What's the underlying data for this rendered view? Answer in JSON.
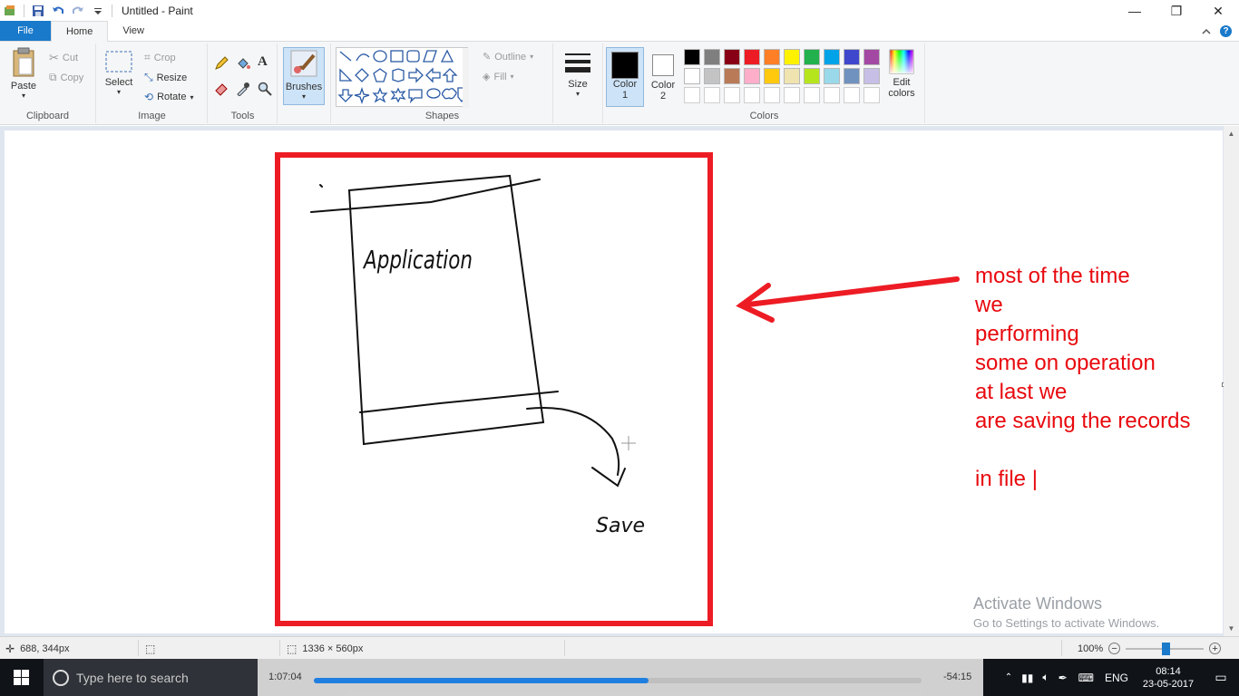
{
  "window": {
    "title": "Untitled - Paint",
    "minimize": "—",
    "maximize": "❐",
    "close": "✕"
  },
  "tabs": [
    "File",
    "Home",
    "View"
  ],
  "ribbon": {
    "clipboard": {
      "label": "Clipboard",
      "paste": "Paste",
      "cut": "Cut",
      "copy": "Copy"
    },
    "image": {
      "label": "Image",
      "select": "Select",
      "crop": "Crop",
      "resize": "Resize",
      "rotate": "Rotate"
    },
    "tools": {
      "label": "Tools"
    },
    "brushes": {
      "label": "Brushes"
    },
    "shapes": {
      "label": "Shapes",
      "outline": "Outline",
      "fill": "Fill"
    },
    "size": {
      "label": "Size"
    },
    "colors": {
      "label": "Colors",
      "color1": "Color",
      "color1_num": "1",
      "color2": "Color",
      "color2_num": "2",
      "edit": "Edit",
      "edit2": "colors",
      "color1_value": "#000000",
      "color2_value": "#ffffff",
      "row1": [
        "#000000",
        "#7f7f7f",
        "#880015",
        "#ed1c24",
        "#ff7f27",
        "#fff200",
        "#22b14c",
        "#00a2e8",
        "#3f48cc",
        "#a349a4"
      ],
      "row2": [
        "#ffffff",
        "#c3c3c3",
        "#b97a57",
        "#ffaec9",
        "#ffc90e",
        "#efe4b0",
        "#b5e61d",
        "#99d9ea",
        "#7092be",
        "#c8bfe7"
      ]
    }
  },
  "canvas": {
    "drawing_text_1": "Application",
    "drawing_text_2": "Save",
    "annotation": [
      "most of the time",
      "we",
      "performing",
      "some on operation",
      "at last we",
      "are saving the records",
      "",
      "in file |"
    ]
  },
  "watermark": {
    "line1": "Activate Windows",
    "line2": "Go to Settings to activate Windows."
  },
  "statusbar": {
    "cursor_pos": "688, 344px",
    "canvas_size": "1336 × 560px",
    "zoom": "100%"
  },
  "taskbar": {
    "search_placeholder": "Type here to search",
    "elapsed": "1:07:04",
    "remaining": "-54:15",
    "progress": 0.55,
    "lang": "ENG",
    "time": "08:14",
    "date": "23-05-2017"
  }
}
